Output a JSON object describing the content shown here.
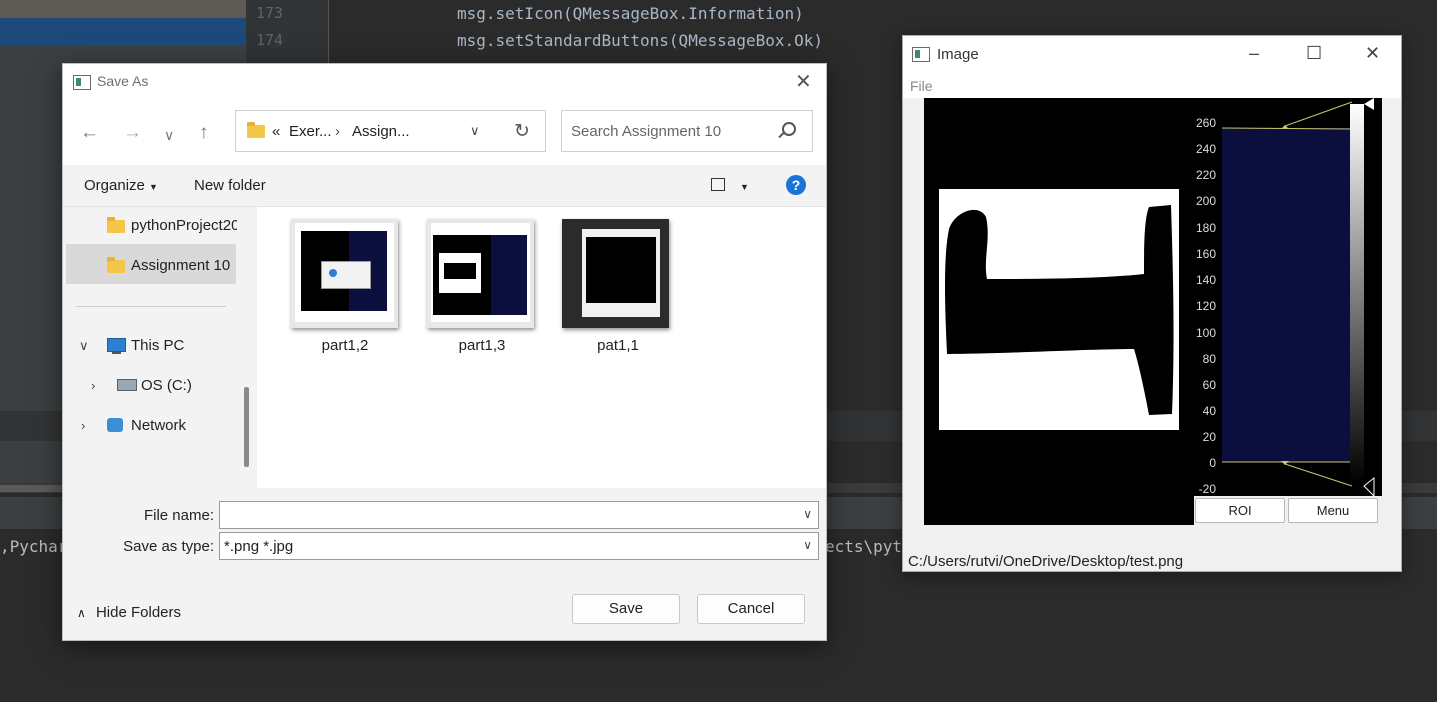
{
  "ide": {
    "line_numbers": [
      "173",
      "174"
    ],
    "code_lines": [
      "msg.setIcon(QMessageBox.Information)",
      "msg.setStandardButtons(QMessageBox.Ok)"
    ],
    "terminal_left": ",Pychar",
    "terminal_right": "ects\\pyt"
  },
  "save_dialog": {
    "title": "Save As",
    "address": {
      "prefix": "«",
      "crumbs": [
        "Exer...",
        "Assign..."
      ],
      "separator": "›"
    },
    "search_placeholder": "Search Assignment 10",
    "commands": {
      "organize": "Organize",
      "new_folder": "New folder",
      "help": "?"
    },
    "tree": [
      {
        "label": "pythonProject20",
        "icon": "folder-icon"
      },
      {
        "label": "Assignment 10",
        "icon": "folder-icon",
        "selected": true
      },
      {
        "label": "This PC",
        "icon": "computer-icon"
      },
      {
        "label": "OS (C:)",
        "icon": "drive-icon"
      },
      {
        "label": "Network",
        "icon": "network-icon"
      }
    ],
    "files": [
      {
        "name": "part1,2"
      },
      {
        "name": "part1,3"
      },
      {
        "name": "pat1,1"
      }
    ],
    "file_name_label": "File name:",
    "file_name_value": "",
    "save_type_label": "Save as type:",
    "save_type_value": "*.png *.jpg",
    "hide_folders": "Hide Folders",
    "save_button": "Save",
    "cancel_button": "Cancel"
  },
  "image_window": {
    "title": "Image",
    "menu_file": "File",
    "histogram_ticks": [
      "260",
      "240",
      "220",
      "200",
      "180",
      "160",
      "140",
      "120",
      "100",
      "80",
      "60",
      "40",
      "20",
      "0",
      "-20"
    ],
    "roi_button": "ROI",
    "menu_button": "Menu",
    "status_path": "C:/Users/rutvi/OneDrive/Desktop/test.png"
  }
}
